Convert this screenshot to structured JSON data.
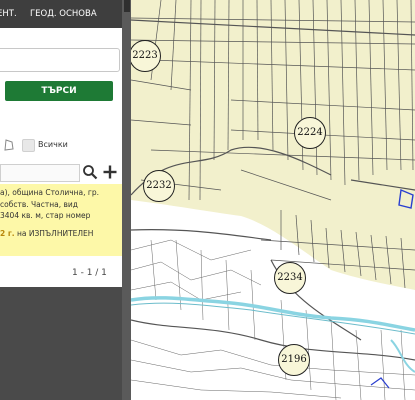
{
  "topbar": {
    "tab_1": "ЕНТ.",
    "tab_2": "ГЕОД. ОСНОВА"
  },
  "search": {
    "query": "",
    "button_label": "ТЪРСИ"
  },
  "filter": {
    "all_label": "Всички"
  },
  "result": {
    "line_1": "а), община Столична, гр.",
    "line_2": "собств. Частна, вид",
    "line_3": "3404 кв. м, стар номер",
    "line_4_bold": "2 г.",
    "line_4_rest": " на ИЗПЪЛНИТЕЛЕН"
  },
  "pagination": {
    "label": "1 - 1 / 1"
  },
  "map": {
    "parcel_labels": [
      "2223",
      "2224",
      "2232",
      "2234",
      "2196"
    ],
    "colors": {
      "farmland": "#f2f0cc",
      "urban": "#ffffff",
      "river": "#8ad4e2",
      "lines": "#555555",
      "parcel_road": "#e6dca2"
    }
  },
  "icons": [
    "polygon-icon",
    "search-icon",
    "plus-icon"
  ]
}
